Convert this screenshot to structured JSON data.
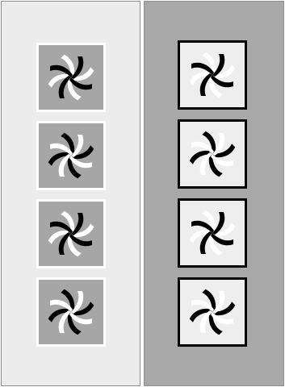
{
  "theme": {
    "left_panel_bg": "#ececec",
    "right_panel_bg": "#a8a8a8",
    "left_tile_bg": "#a6a6a6",
    "left_tile_border": "#ffffff",
    "right_tile_bg": "#eeeeee",
    "right_tile_border": "#000000",
    "pinwheel_light": "#ffffff",
    "pinwheel_dark": "#000000"
  },
  "panels": [
    {
      "id": "left",
      "tiles": [
        {
          "icon": "pinwheel-icon",
          "front": "dark",
          "back": "light"
        },
        {
          "icon": "pinwheel-icon",
          "front": "light",
          "back": "dark"
        },
        {
          "icon": "pinwheel-icon",
          "front": "dark",
          "back": "light"
        },
        {
          "icon": "pinwheel-icon",
          "front": "light",
          "back": "dark"
        }
      ]
    },
    {
      "id": "right",
      "tiles": [
        {
          "icon": "pinwheel-icon",
          "front": "dark",
          "back": "light"
        },
        {
          "icon": "pinwheel-icon",
          "front": "light",
          "back": "dark"
        },
        {
          "icon": "pinwheel-icon",
          "front": "dark",
          "back": "light"
        },
        {
          "icon": "pinwheel-icon",
          "front": "light",
          "back": "dark"
        }
      ]
    }
  ]
}
